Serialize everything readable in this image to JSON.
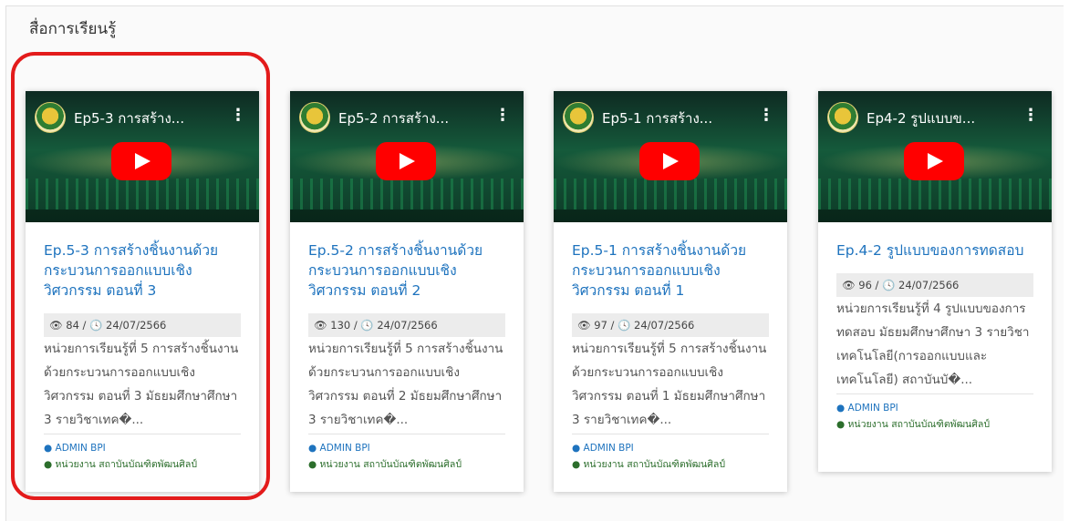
{
  "section_title": "สื่อการเรียนรู้",
  "cards": [
    {
      "video_title": "Ep5-3 การสร้าง...",
      "title": "Ep.5-3 การสร้างชิ้นงานด้วยกระบวนการออกแบบเชิงวิศวกรรม ตอนที่ 3",
      "meta": "👁 84 / 🕓 24/07/2566",
      "description": "หน่วยการเรียนรู้ที่ 5 การสร้างชิ้นงานด้วยกระบวนการออกแบบเชิงวิศวกรรม ตอนที่ 3 มัธยมศึกษาศึกษา 3 รายวิชาเทค�...",
      "author": "ADMIN BPI",
      "unit": "หน่วยงาน สถาบันบัณฑิตพัฒนศิลป์"
    },
    {
      "video_title": "Ep5-2 การสร้าง...",
      "title": "Ep.5-2 การสร้างชิ้นงานด้วยกระบวนการออกแบบเชิงวิศวกรรม ตอนที่ 2",
      "meta": "👁 130 / 🕓 24/07/2566",
      "description": "หน่วยการเรียนรู้ที่ 5 การสร้างชิ้นงานด้วยกระบวนการออกแบบเชิงวิศวกรรม ตอนที่ 2 มัธยมศึกษาศึกษา 3 รายวิชาเทค�...",
      "author": "ADMIN BPI",
      "unit": "หน่วยงาน สถาบันบัณฑิตพัฒนศิลป์"
    },
    {
      "video_title": "Ep5-1 การสร้าง...",
      "title": "Ep.5-1 การสร้างชิ้นงานด้วยกระบวนการออกแบบเชิงวิศวกรรม ตอนที่ 1",
      "meta": "👁 97 / 🕓 24/07/2566",
      "description": "หน่วยการเรียนรู้ที่ 5 การสร้างชิ้นงานด้วยกระบวนการออกแบบเชิงวิศวกรรม ตอนที่ 1 มัธยมศึกษาศึกษา 3 รายวิชาเทค�...",
      "author": "ADMIN BPI",
      "unit": "หน่วยงาน สถาบันบัณฑิตพัฒนศิลป์"
    },
    {
      "video_title": "Ep4-2 รูปแบบข...",
      "title": "Ep.4-2 รูปแบบของการทดสอบ",
      "meta": "👁 96 / 🕓 24/07/2566",
      "description": "หน่วยการเรียนรู้ที่ 4 รูปแบบของการทดสอบ มัธยมศึกษาศึกษา 3 รายวิชาเทคโนโลยี(การออกแบบและเทคโนโลยี) สถาบันบั�...",
      "author": "ADMIN BPI",
      "unit": "หน่วยงาน สถาบันบัณฑิตพัฒนศิลป์"
    }
  ],
  "colors": {
    "title_link": "#1e73be",
    "unit_text": "#2c6e2c",
    "highlight": "#e31b1b",
    "play_button": "#ff0000"
  }
}
